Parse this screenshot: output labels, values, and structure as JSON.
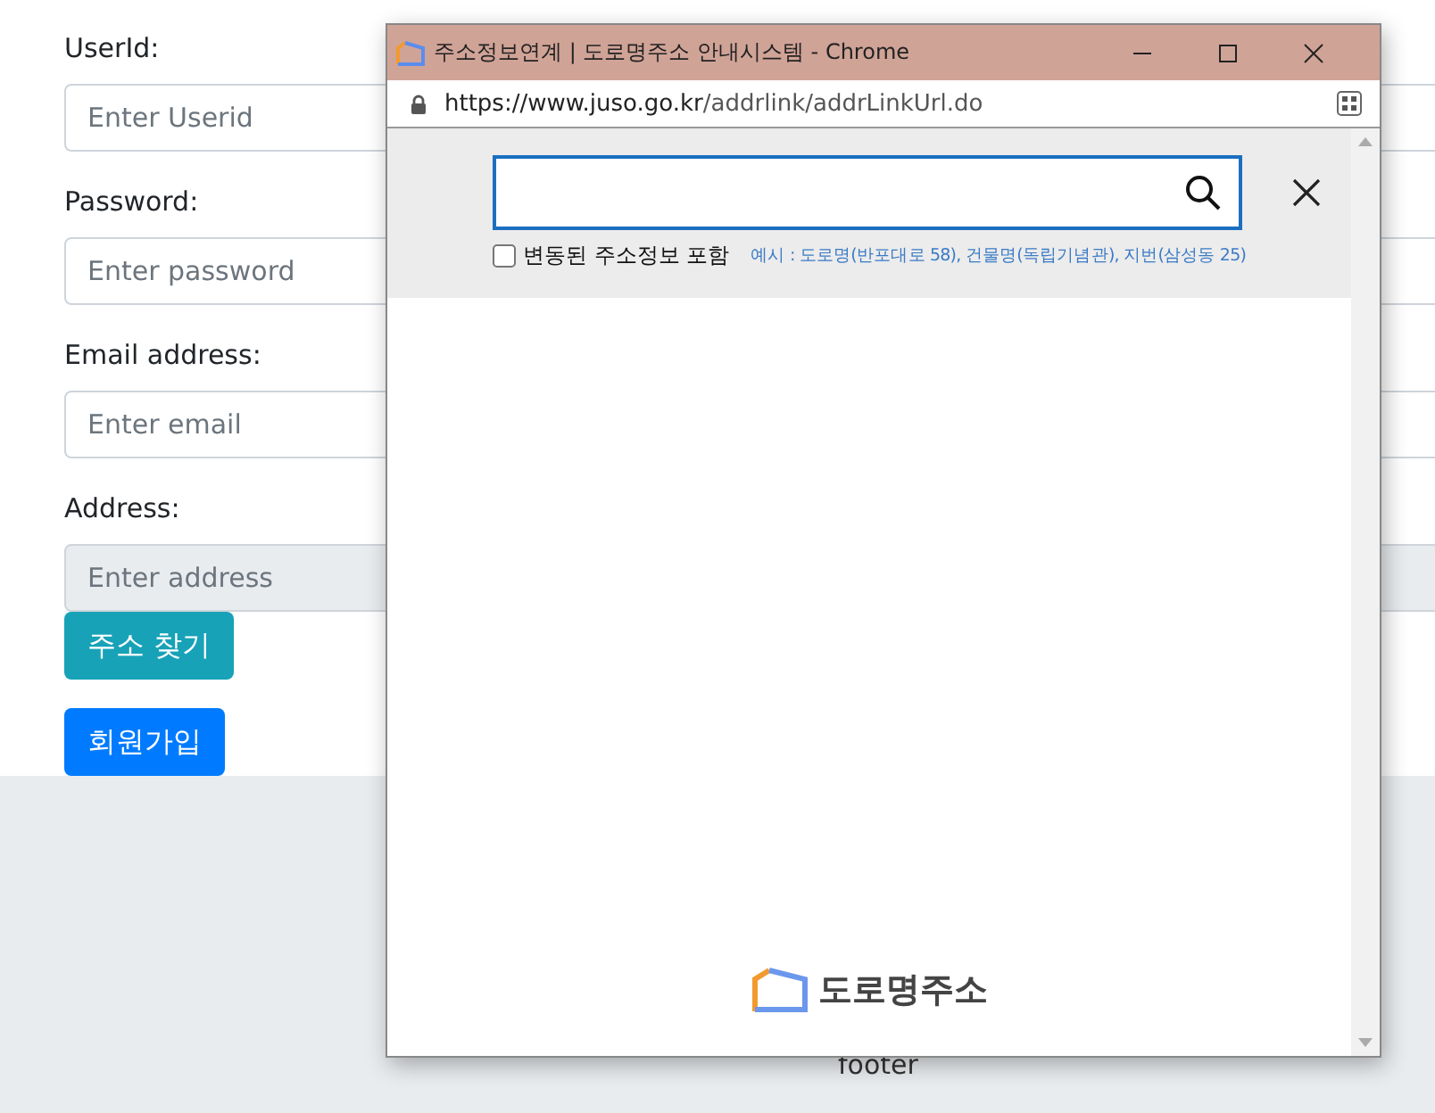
{
  "form": {
    "fields": [
      {
        "label": "UserId:",
        "placeholder": "Enter Userid",
        "readonly": false
      },
      {
        "label": "Password:",
        "placeholder": "Enter password",
        "readonly": false
      },
      {
        "label": "Email address:",
        "placeholder": "Enter email",
        "readonly": false
      },
      {
        "label": "Address:",
        "placeholder": "Enter address",
        "readonly": true
      }
    ],
    "buttons": [
      {
        "label": "주소 찾기",
        "kind": "info"
      },
      {
        "label": "회원가입",
        "kind": "primary"
      }
    ]
  },
  "footer": {
    "text": "footer"
  },
  "popup": {
    "window": {
      "title": "주소정보연계 | 도로명주소 안내시스템 - Chrome",
      "url_host": "https://www.juso.go.kr",
      "url_path": "/addrlink/addrLinkUrl.do"
    },
    "include_changed": {
      "label": "변동된 주소정보 포함",
      "checked": false
    },
    "example": "예시 : 도로명(반포대로 58), 건물명(독립기념관), 지번(삼성동 25)",
    "logo_text": "도로명주소"
  }
}
